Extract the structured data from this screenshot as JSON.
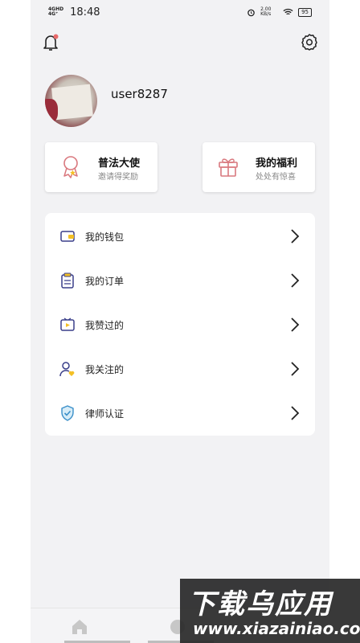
{
  "status_bar": {
    "signal1": "4GHD",
    "signal2": "4G⁺",
    "time": "18:48",
    "speed": "2.00 KB/s",
    "battery": "95"
  },
  "profile": {
    "username": "user8287"
  },
  "cards": [
    {
      "title": "普法大使",
      "subtitle": "邀请得奖励",
      "icon": "ambassador-medal-icon"
    },
    {
      "title": "我的福利",
      "subtitle": "处处有惊喜",
      "icon": "gift-icon"
    }
  ],
  "menu": [
    {
      "label": "我的钱包",
      "icon": "wallet-icon"
    },
    {
      "label": "我的订单",
      "icon": "order-clipboard-icon"
    },
    {
      "label": "我赞过的",
      "icon": "liked-video-icon"
    },
    {
      "label": "我关注的",
      "icon": "following-user-icon"
    },
    {
      "label": "律师认证",
      "icon": "shield-check-icon"
    }
  ],
  "watermark": {
    "title": "下载乌应用",
    "url": "www.xiazainiao.com"
  },
  "colors": {
    "accent_red": "#e86a6a",
    "gold": "#f4c025",
    "blue": "#3a6fd8",
    "background": "#f2f2f4"
  }
}
